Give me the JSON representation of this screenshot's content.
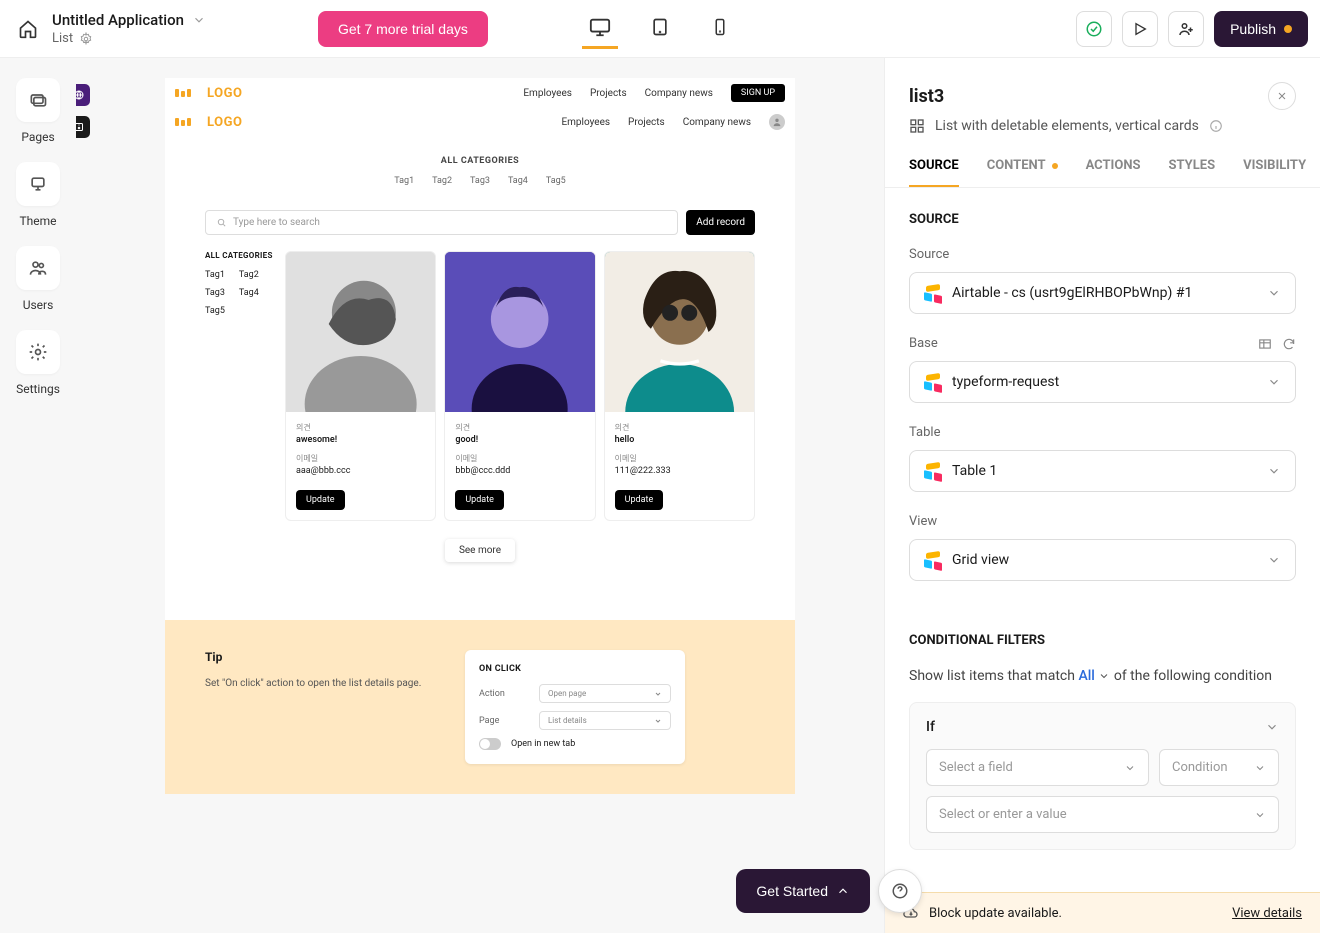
{
  "header": {
    "app_title": "Untitled Application",
    "subtitle": "List",
    "trial_btn": "Get 7 more trial days",
    "publish": "Publish"
  },
  "left_sidebar": [
    {
      "label": "Pages"
    },
    {
      "label": "Theme"
    },
    {
      "label": "Users"
    },
    {
      "label": "Settings"
    }
  ],
  "preview": {
    "logo_word": "LOGO",
    "nav1": [
      "Employees",
      "Projects",
      "Company news"
    ],
    "signup": "SIGN UP",
    "nav2": [
      "Employees",
      "Projects",
      "Company news"
    ],
    "all_categories": "ALL CATEGORIES",
    "tags": [
      "Tag1",
      "Tag2",
      "Tag3",
      "Tag4",
      "Tag5"
    ],
    "search_placeholder": "Type here to search",
    "add_record": "Add record",
    "side_all_cat": "ALL CATEGORIES",
    "side_tags": [
      "Tag1",
      "Tag2",
      "Tag3",
      "Tag4",
      "Tag5"
    ],
    "cards": [
      {
        "lbl1": "의견",
        "val1": "awesome!",
        "lbl2": "이메일",
        "val2": "aaa@bbb.ccc",
        "btn": "Update",
        "bg": "#bfbfbf"
      },
      {
        "lbl1": "의견",
        "val1": "good!",
        "lbl2": "이메일",
        "val2": "bbb@ccc.ddd",
        "btn": "Update",
        "bg": "#5a4db8"
      },
      {
        "lbl1": "의견",
        "val1": "hello",
        "lbl2": "이메일",
        "val2": "111@222.333",
        "btn": "Update",
        "bg": "#0d8c8c"
      }
    ],
    "see_more": "See more"
  },
  "tip": {
    "title": "Tip",
    "text": "Set \"On click\" action to open the list details page.",
    "card_hdr": "ON CLICK",
    "action_lbl": "Action",
    "action_val": "Open page",
    "page_lbl": "Page",
    "page_val": "List details",
    "newtab": "Open in new tab"
  },
  "get_started": "Get Started",
  "right_panel": {
    "title": "list3",
    "subtitle": "List with deletable elements, vertical cards",
    "tabs": [
      "SOURCE",
      "CONTENT",
      "ACTIONS",
      "STYLES",
      "VISIBILITY"
    ],
    "source_hdr": "SOURCE",
    "source_lbl": "Source",
    "source_val": "Airtable - cs (usrt9gElRHBOPbWnp) #1",
    "base_lbl": "Base",
    "base_val": "typeform-request",
    "table_lbl": "Table",
    "table_val": "Table 1",
    "view_lbl": "View",
    "view_val": "Grid view",
    "cond_hdr": "CONDITIONAL FILTERS",
    "cond_prefix": "Show list items that match",
    "cond_all": "All",
    "cond_suffix": "of the following condition",
    "if": "If",
    "select_field": "Select a field",
    "condition": "Condition",
    "select_value": "Select or enter a value"
  },
  "update_banner": {
    "text": "Block update available.",
    "link": "View details"
  }
}
